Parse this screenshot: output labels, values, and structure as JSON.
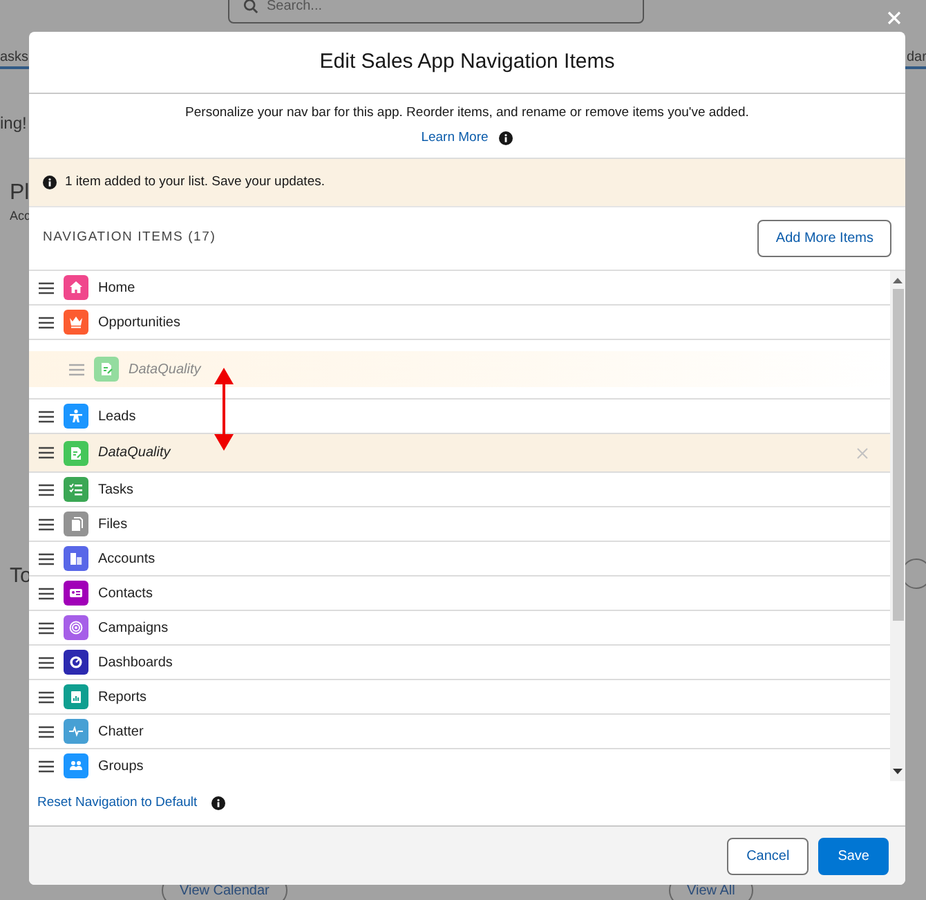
{
  "background": {
    "search_placeholder": "Search...",
    "tab_left": "asks",
    "tab_right": "dar",
    "banner_fragment": "ing!",
    "card_title_fragment": "Pl",
    "card_subtitle_fragment": "Acc",
    "section_title_fragment": "To",
    "buttons": [
      "View Calendar",
      "View All"
    ]
  },
  "modal": {
    "title": "Edit Sales App Navigation Items",
    "description": "Personalize your nav bar for this app. Reorder items, and rename or remove items you've added.",
    "learn_more": "Learn More",
    "alert": "1 item added to your list. Save your updates.",
    "section_heading": "NAVIGATION ITEMS (17)",
    "add_button": "Add More Items",
    "items": [
      {
        "kind": "item",
        "label": "Home",
        "color": "#f0478c",
        "added": false
      },
      {
        "kind": "item",
        "label": "Opportunities",
        "color": "#fc5c30",
        "added": false
      },
      {
        "kind": "ghost",
        "label": "DataQuality",
        "color": "#94dc9f"
      },
      {
        "kind": "item",
        "label": "Leads",
        "color": "#1b96ff",
        "added": false
      },
      {
        "kind": "item",
        "label": "DataQuality",
        "color": "#45c65a",
        "added": true
      },
      {
        "kind": "item",
        "label": "Tasks",
        "color": "#3ba755",
        "added": false
      },
      {
        "kind": "item",
        "label": "Files",
        "color": "#939393",
        "added": false
      },
      {
        "kind": "item",
        "label": "Accounts",
        "color": "#5867e8",
        "added": false
      },
      {
        "kind": "item",
        "label": "Contacts",
        "color": "#a100b8",
        "added": false
      },
      {
        "kind": "item",
        "label": "Campaigns",
        "color": "#a65fe8",
        "added": false
      },
      {
        "kind": "item",
        "label": "Dashboards",
        "color": "#2c2ab0",
        "added": false
      },
      {
        "kind": "item",
        "label": "Reports",
        "color": "#0f9f90",
        "added": false
      },
      {
        "kind": "item",
        "label": "Chatter",
        "color": "#47a0d4",
        "added": false
      },
      {
        "kind": "item",
        "label": "Groups",
        "color": "#1b96ff",
        "added": false
      }
    ],
    "reset_link": "Reset Navigation to Default",
    "footer_buttons": [
      {
        "label": "Cancel",
        "kind": "neutral"
      },
      {
        "label": "Save",
        "kind": "brand"
      }
    ]
  }
}
